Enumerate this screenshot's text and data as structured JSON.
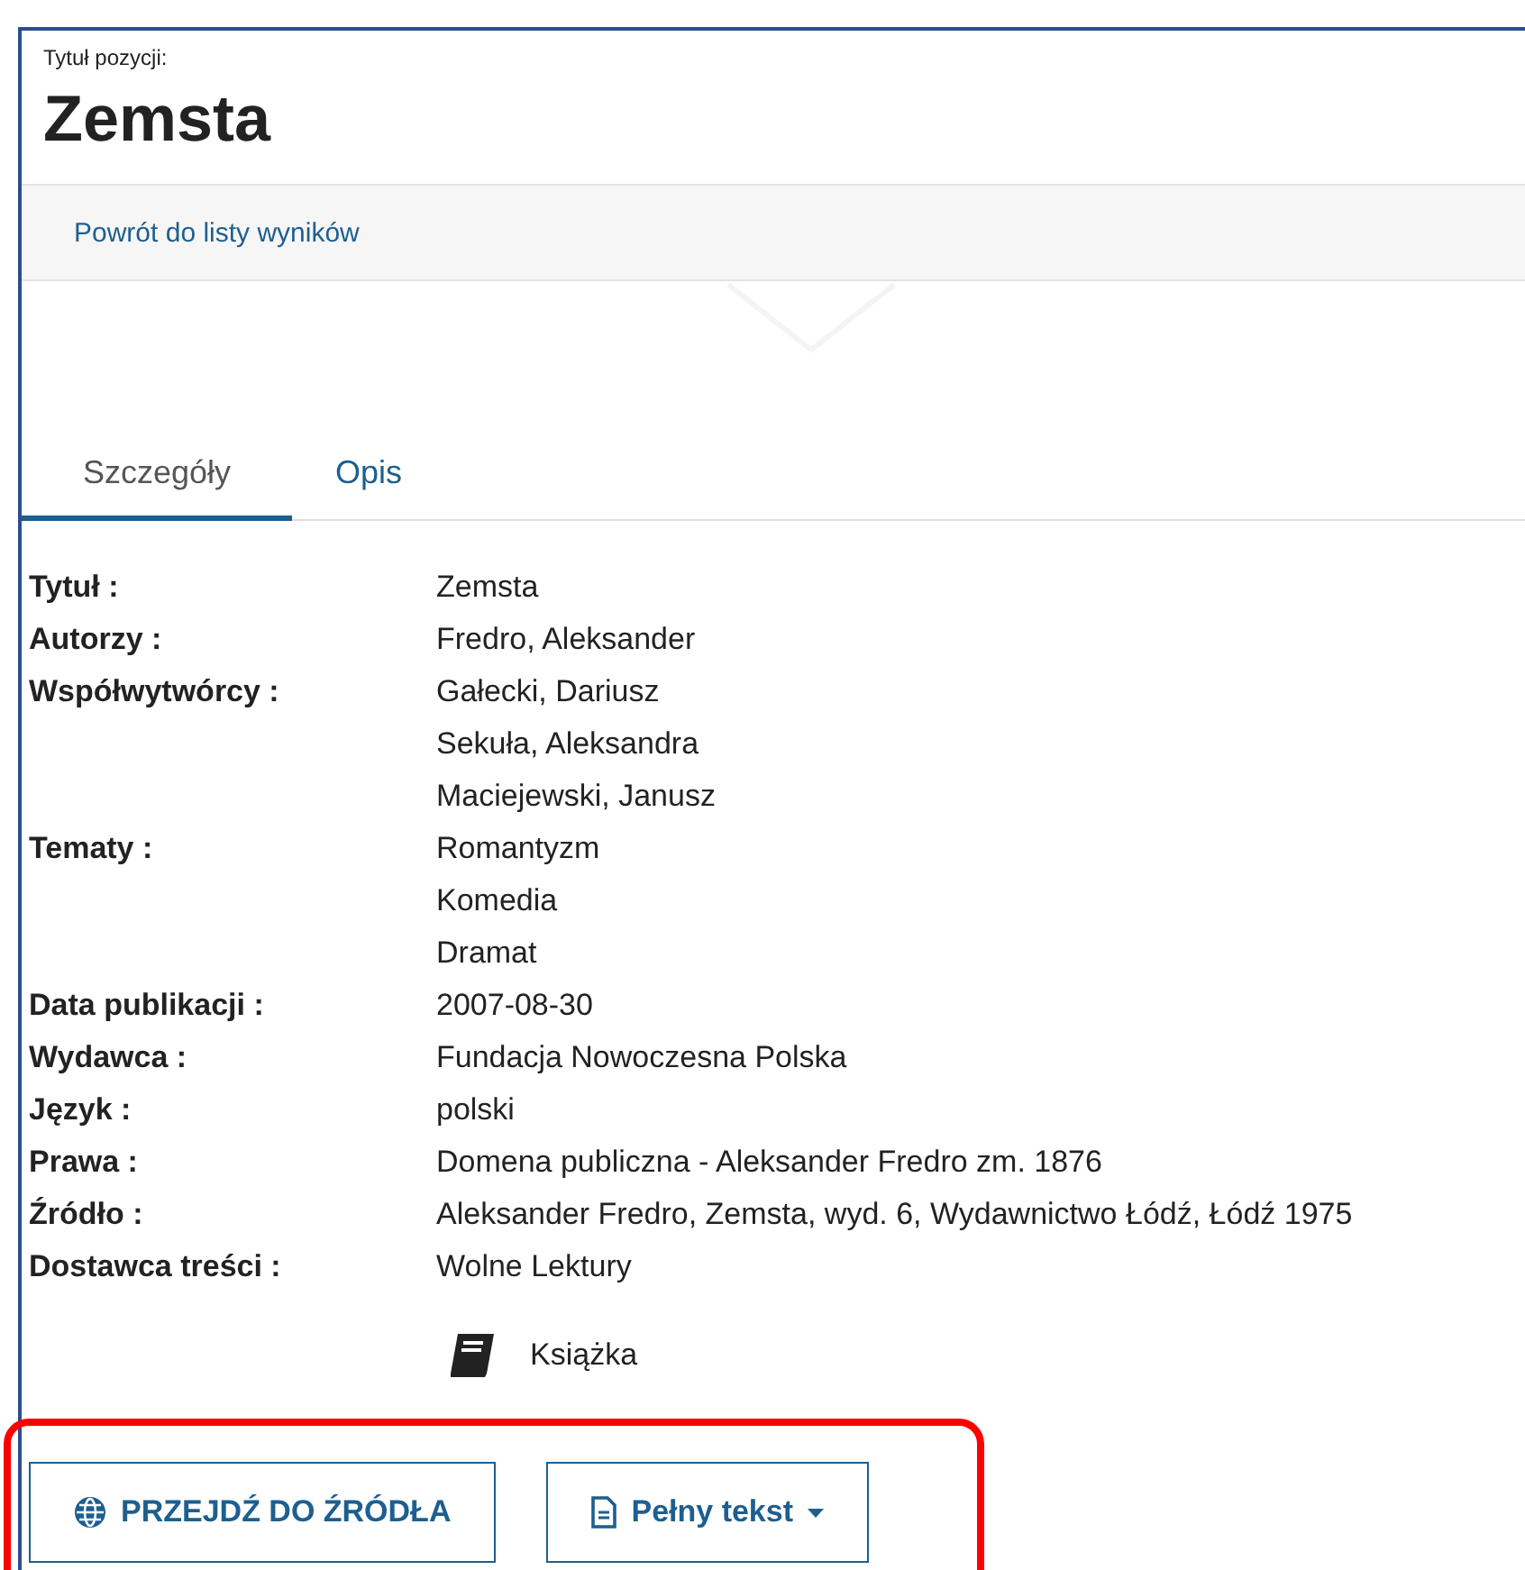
{
  "header": {
    "caption": "Tytuł pozycji:",
    "title": "Zemsta"
  },
  "back_link": "Powrót do listy wyników",
  "tabs": [
    {
      "label": "Szczegóły",
      "selected": true
    },
    {
      "label": "Opis",
      "selected": false
    }
  ],
  "details": [
    {
      "label": "Tytuł :",
      "values": [
        "Zemsta"
      ]
    },
    {
      "label": "Autorzy :",
      "values": [
        "Fredro, Aleksander"
      ]
    },
    {
      "label": "Współwytwórcy :",
      "values": [
        "Gałecki, Dariusz",
        "Sekuła, Aleksandra",
        "Maciejewski, Janusz"
      ]
    },
    {
      "label": "Tematy :",
      "values": [
        "Romantyzm",
        "Komedia",
        "Dramat"
      ]
    },
    {
      "label": "Data publikacji :",
      "values": [
        "2007-08-30"
      ]
    },
    {
      "label": "Wydawca :",
      "values": [
        "Fundacja Nowoczesna Polska"
      ]
    },
    {
      "label": "Język :",
      "values": [
        "polski"
      ]
    },
    {
      "label": "Prawa :",
      "values": [
        "Domena publiczna - Aleksander Fredro zm. 1876"
      ]
    },
    {
      "label": "Źródło :",
      "values": [
        "Aleksander Fredro, Zemsta, wyd. 6, Wydawnictwo Łódź, Łódź 1975"
      ]
    },
    {
      "label": "Dostawca treści :",
      "values": [
        "Wolne Lektury"
      ]
    }
  ],
  "format": {
    "kind": "book",
    "label": "Książka"
  },
  "buttons": [
    {
      "kind": "link",
      "label": "PRZEJDŹ DO ŹRÓDŁA"
    },
    {
      "kind": "dropdown",
      "label": "Pełny tekst"
    }
  ]
}
